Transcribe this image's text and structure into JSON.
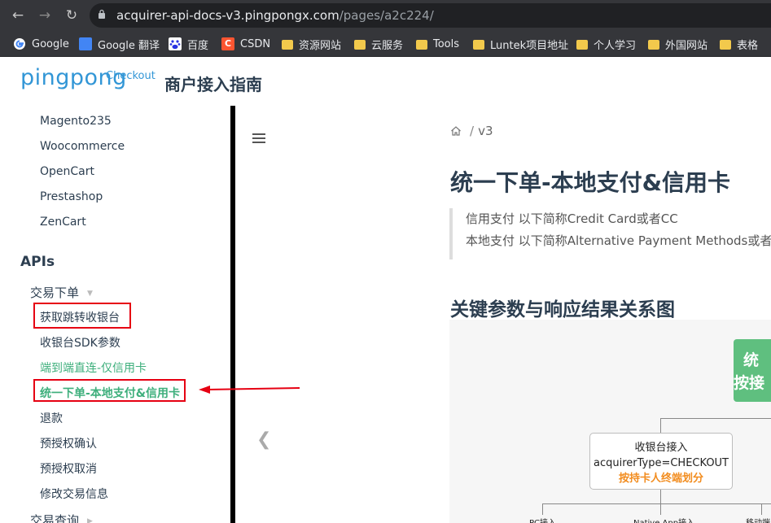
{
  "browser": {
    "url_host": "acquirer-api-docs-v3.pingpongx.com",
    "url_path": "/pages/a2c224/",
    "bookmarks": [
      {
        "label": "Google",
        "icon": "google-icon"
      },
      {
        "label": "Google 翻译",
        "icon": "google-translate-icon"
      },
      {
        "label": "百度",
        "icon": "baidu-icon"
      },
      {
        "label": "CSDN",
        "icon": "csdn-icon"
      },
      {
        "label": "资源网站",
        "icon": "folder-icon"
      },
      {
        "label": "云服务",
        "icon": "folder-icon"
      },
      {
        "label": "Tools",
        "icon": "folder-icon"
      },
      {
        "label": "Luntek项目地址",
        "icon": "folder-icon"
      },
      {
        "label": "个人学习",
        "icon": "folder-icon"
      },
      {
        "label": "外国网站",
        "icon": "folder-icon"
      },
      {
        "label": "表格",
        "icon": "folder-icon"
      }
    ]
  },
  "header": {
    "logo": "pingpong",
    "logo_sub": "Checkout",
    "title": "商户接入指南"
  },
  "sidebar": {
    "plugins": [
      "Magento235",
      "Woocommerce",
      "OpenCart",
      "Prestashop",
      "ZenCart"
    ],
    "section": "APIs",
    "group1": "交易下单",
    "group1_items": [
      "获取跳转收银台",
      "收银台SDK参数",
      "端到端直连-仅信用卡",
      "统一下单-本地支付&信用卡",
      "退款",
      "预授权确认",
      "预授权取消",
      "修改交易信息"
    ],
    "group2": "交易查询"
  },
  "content": {
    "breadcrumb_version": "v3",
    "page_title": "统一下单-本地支付&信用卡",
    "quote_lines": [
      "信用支付 以下简称Credit Card或者CC",
      "本地支付 以下简称Alternative Payment Methods或者..."
    ],
    "section_title": "关键参数与响应结果关系图",
    "diagram": {
      "green_box_lines": [
        "统",
        "按接"
      ],
      "checkout_box": [
        "收银台接入",
        "acquirerType=CHECKOUT",
        "按持卡人终端划分"
      ],
      "bottom_labels": [
        "PC接入",
        "Native App接入",
        "移动端"
      ]
    }
  },
  "colors": {
    "brand": "#3296d6",
    "accent_green": "#3eaf7c",
    "highlight_red": "#e60012"
  }
}
